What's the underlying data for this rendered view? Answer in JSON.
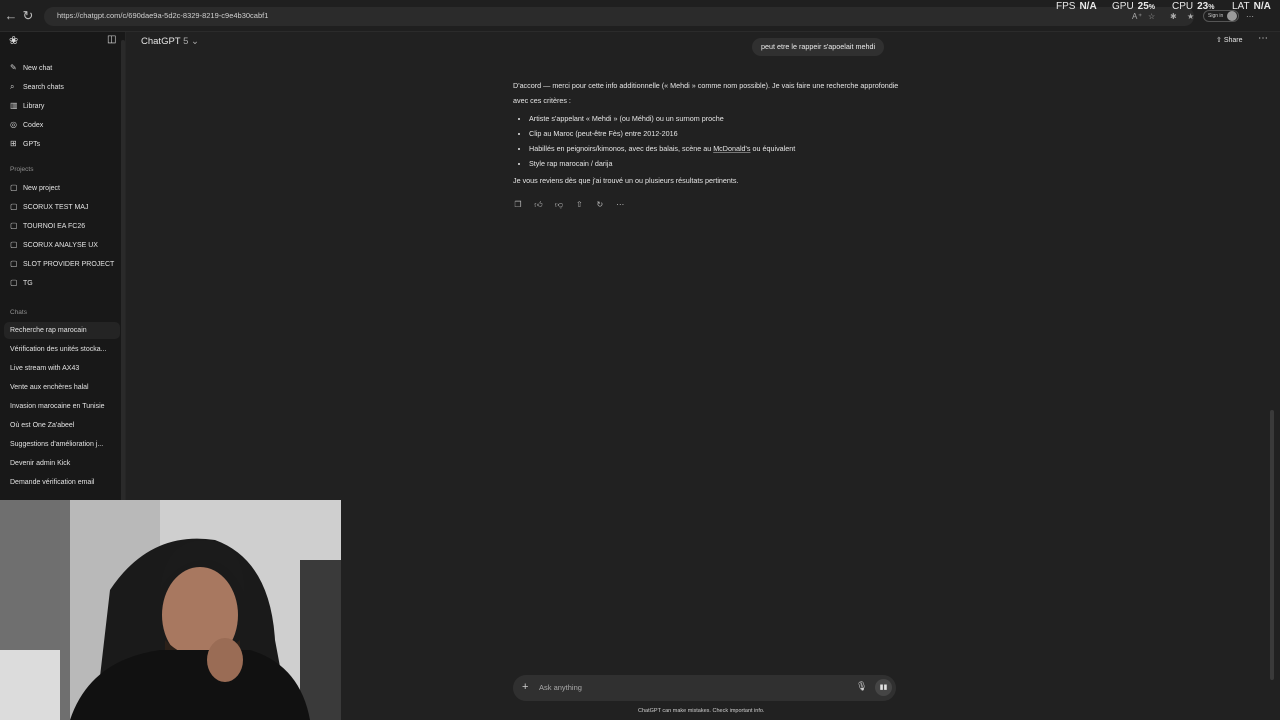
{
  "browser": {
    "url": "https://chatgpt.com/c/690dae9a-5d2c-8329-8219-c9e4b30cabf1",
    "signin_label": "Sign in"
  },
  "overlay": {
    "fps_label": "FPS",
    "fps_value": "N/A",
    "gpu_label": "GPU",
    "gpu_value": "25",
    "gpu_unit": "%",
    "cpu_label": "CPU",
    "cpu_value": "23",
    "cpu_unit": "%",
    "lat_label": "LAT",
    "lat_value": "N/A"
  },
  "sidebar": {
    "nav": [
      {
        "label": "New chat",
        "icon": "pencil-square-icon"
      },
      {
        "label": "Search chats",
        "icon": "search-icon"
      },
      {
        "label": "Library",
        "icon": "library-icon"
      },
      {
        "label": "Codex",
        "icon": "codex-icon"
      },
      {
        "label": "GPTs",
        "icon": "grid-icon"
      }
    ],
    "projects_heading": "Projects",
    "projects": [
      {
        "label": "New project",
        "icon": "folder-plus-icon"
      },
      {
        "label": "SCORUX TEST MAJ",
        "icon": "folder-icon"
      },
      {
        "label": "TOURNOI EA FC26",
        "icon": "folder-icon"
      },
      {
        "label": "SCORUX ANALYSE UX",
        "icon": "folder-icon"
      },
      {
        "label": "SLOT PROVIDER PROJECT",
        "icon": "folder-icon"
      },
      {
        "label": "TG",
        "icon": "folder-icon"
      }
    ],
    "chats_heading": "Chats",
    "chats": [
      "Recherche rap marocain",
      "Vérification des unités stocka...",
      "Live stream with AX43",
      "Vente aux enchères halal",
      "Invasion marocaine en Tunisie",
      "Où est One Za'abeel",
      "Suggestions d'amélioration j...",
      "Devenir admin Kick",
      "Demande vérification email"
    ]
  },
  "header": {
    "model": "ChatGPT",
    "version": "5",
    "share_label": "Share"
  },
  "conversation": {
    "user_message": "peut etre le rappeir s'apoelait mehdi",
    "assistant_intro": "D'accord — merci pour cette info additionnelle (« Mehdi » comme nom possible). Je vais faire une recherche approfondie avec ces critères :",
    "criteria": [
      "Artiste s'appelant « Mehdi » (ou Méhdi) ou un surnom proche",
      "Clip au Maroc (peut-être Fès) entre 2012-2016",
      "Style rap marocain / darija"
    ],
    "criteria_3_pre": "Habillés en peignoirs/kimonos, avec des balais, scène au ",
    "criteria_3_link": "McDonald's",
    "criteria_3_post": " ou équivalent",
    "assistant_outro": "Je vous reviens dès que j'ai trouvé un ou plusieurs résultats pertinents."
  },
  "composer": {
    "placeholder": "Ask anything",
    "disclaimer": "ChatGPT can make mistakes. Check important info."
  }
}
